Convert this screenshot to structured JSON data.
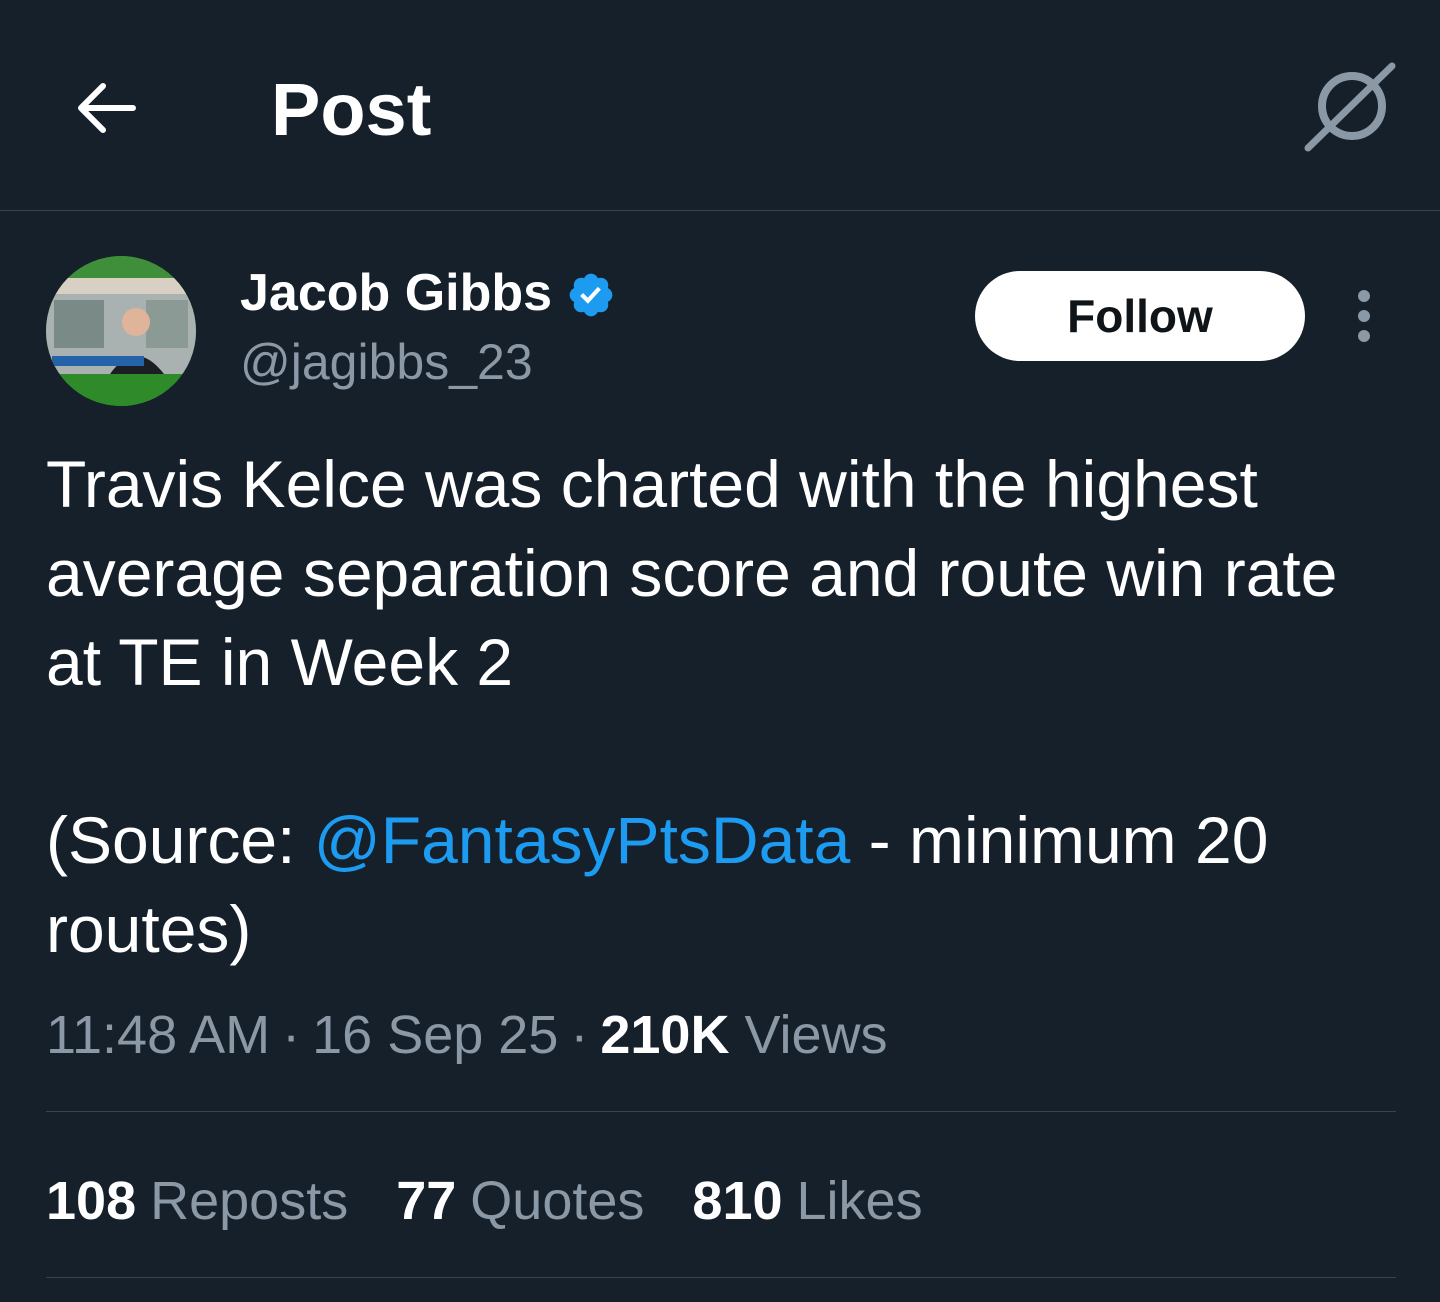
{
  "header": {
    "title": "Post",
    "back_icon": "arrow-left-icon",
    "grok_icon": "grok-icon"
  },
  "author": {
    "name": "Jacob Gibbs",
    "handle": "@jagibbs_23",
    "verified": true,
    "verified_color": "#1d9bf0",
    "follow_label": "Follow",
    "more_icon": "more-vertical-icon"
  },
  "tweet": {
    "text": "Travis Kelce was charted with the highest average separation score and route win rate at TE in Week 2",
    "source_prefix": "(Source: ",
    "source_mention": "@FantasyPtsData",
    "source_suffix": " - minimum 20 routes)"
  },
  "meta": {
    "time": "11:48 AM",
    "date": "16 Sep 25",
    "views_count": "210K",
    "views_label": "Views"
  },
  "stats": {
    "reposts_count": "108",
    "reposts_label": "Reposts",
    "quotes_count": "77",
    "quotes_label": "Quotes",
    "likes_count": "810",
    "likes_label": "Likes"
  },
  "colors": {
    "background": "#15202b",
    "accent": "#1d9bf0",
    "secondary_text": "#8b98a5"
  }
}
